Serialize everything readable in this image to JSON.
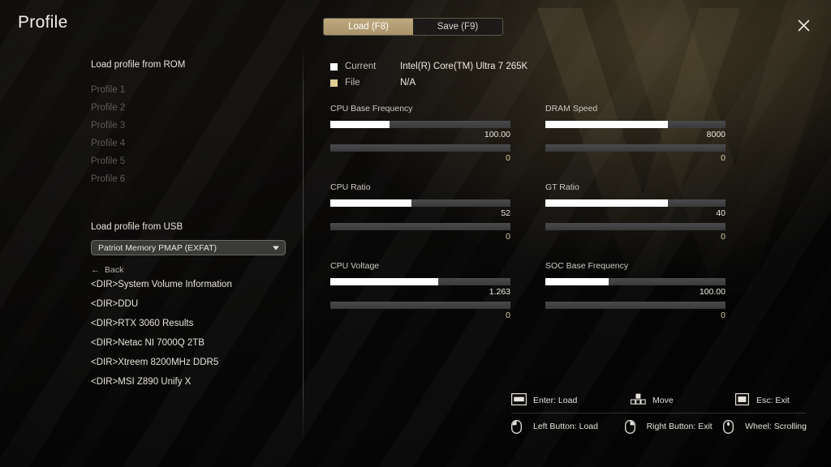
{
  "header": {
    "title": "Profile",
    "close_icon": "close-icon",
    "tabs": [
      {
        "label": "Load (F8)",
        "active": true
      },
      {
        "label": "Save (F9)",
        "active": false
      }
    ]
  },
  "left_panel": {
    "rom_section_title": "Load profile from ROM",
    "profiles": [
      {
        "label": "Profile 1",
        "enabled": false
      },
      {
        "label": "Profile 2",
        "enabled": false
      },
      {
        "label": "Profile 3",
        "enabled": false
      },
      {
        "label": "Profile 4",
        "enabled": false
      },
      {
        "label": "Profile 5",
        "enabled": false
      },
      {
        "label": "Profile 6",
        "enabled": false
      }
    ],
    "usb_section_title": "Load profile from USB",
    "usb_device": {
      "selected": "Patriot Memory PMAP (EXFAT)",
      "chevron_icon": "chevron-down-icon"
    },
    "back_label": "Back",
    "back_icon": "arrow-left-icon",
    "files": [
      "<DIR>System Volume Information",
      "<DIR>DDU",
      "<DIR>RTX 3060 Results",
      "<DIR>Netac NI 7000Q 2TB",
      "<DIR>Xtreem 8200MHz DDR5",
      "<DIR>MSI Z890 Unify X"
    ]
  },
  "right_panel": {
    "legend": [
      {
        "label": "Current",
        "value": "Intel(R) Core(TM) Ultra 7 265K",
        "color": "#ffffff"
      },
      {
        "label": "File",
        "value": "N/A",
        "color": "#e2cd96"
      }
    ],
    "metrics": [
      {
        "title": "CPU Base Frequency",
        "current": {
          "value": "100.00",
          "pct": 33
        },
        "file": {
          "value": "0",
          "pct": 0
        }
      },
      {
        "title": "DRAM Speed",
        "current": {
          "value": "8000",
          "pct": 68
        },
        "file": {
          "value": "0",
          "pct": 0
        }
      },
      {
        "title": "CPU Ratio",
        "current": {
          "value": "52",
          "pct": 45
        },
        "file": {
          "value": "0",
          "pct": 0
        }
      },
      {
        "title": "GT Ratio",
        "current": {
          "value": "40",
          "pct": 68
        },
        "file": {
          "value": "0",
          "pct": 0
        }
      },
      {
        "title": "CPU Voltage",
        "current": {
          "value": "1.263",
          "pct": 60
        },
        "file": {
          "value": "0",
          "pct": 0
        }
      },
      {
        "title": "SOC Base Frequency",
        "current": {
          "value": "100.00",
          "pct": 35
        },
        "file": {
          "value": "0",
          "pct": 0
        }
      }
    ]
  },
  "hints": {
    "row_keyboard": [
      {
        "icon": "enter-key-icon",
        "label": "Enter: Load"
      },
      {
        "icon": "arrow-keys-icon",
        "label": "Move"
      },
      {
        "icon": "esc-key-icon",
        "label": "Esc: Exit"
      }
    ],
    "row_mouse": [
      {
        "icon": "mouse-left-button-icon",
        "label": "Left Button: Load"
      },
      {
        "icon": "mouse-right-button-icon",
        "label": "Right Button: Exit"
      },
      {
        "icon": "mouse-wheel-icon",
        "label": "Wheel: Scrolling"
      }
    ]
  },
  "colors": {
    "accent": "#b5a077",
    "current_bar": "#ffffff",
    "file_bar": "#d9c48d",
    "track": "#444447"
  }
}
